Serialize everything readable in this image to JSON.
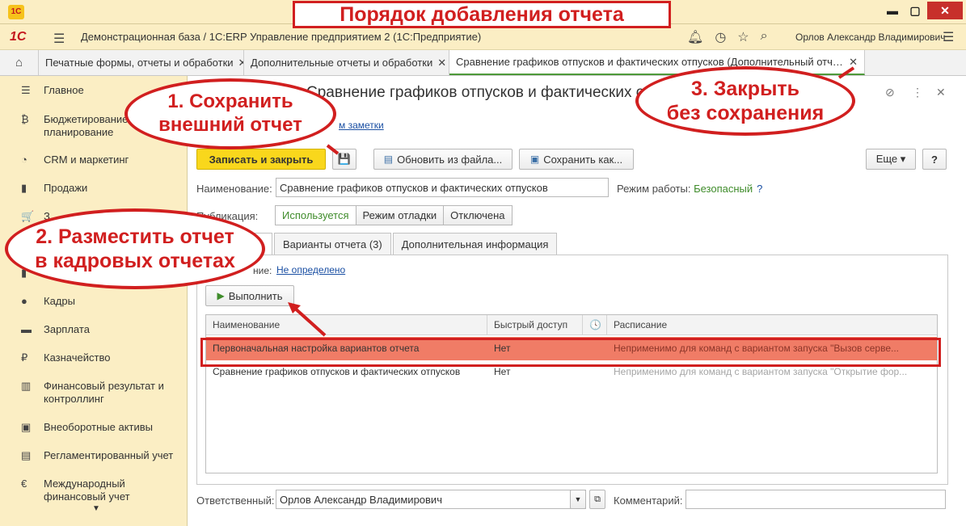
{
  "window": {
    "logo": "1С",
    "btn_min": "▬",
    "btn_max": "▢",
    "btn_close": "✕"
  },
  "annotation_title": "Порядок добавления отчета",
  "header": {
    "brand": "1С",
    "title": "Демонстрационная база / 1С:ERP Управление предприятием 2  (1С:Предприятие)",
    "user": "Орлов Александр Владимирович",
    "icons": [
      "bell-icon",
      "history-icon",
      "star-icon",
      "search-icon"
    ]
  },
  "tabs": [
    {
      "label": "Печатные формы, отчеты и обработки",
      "close": "✕"
    },
    {
      "label": "Дополнительные отчеты и обработки",
      "close": "✕"
    },
    {
      "label": "Сравнение графиков отпусков и фактических отпусков (Дополнительный отчет)",
      "close": "✕"
    }
  ],
  "sidebar": {
    "items": [
      {
        "icon": "☰",
        "label": "Главное"
      },
      {
        "icon": "₿",
        "label": "Бюджетирование и",
        "label2": "планирование"
      },
      {
        "icon": "◔",
        "label": "CRM и маркетинг"
      },
      {
        "icon": "▮",
        "label": "Продажи"
      },
      {
        "icon": "🛒",
        "label": "З"
      },
      {
        "icon": "▮",
        "label": ""
      },
      {
        "icon": "▮",
        "label": ""
      },
      {
        "icon": "●",
        "label": "Кадры"
      },
      {
        "icon": "▬",
        "label": "Зарплата"
      },
      {
        "icon": "₽",
        "label": "Казначейство"
      },
      {
        "icon": "▥",
        "label": "Финансовый результат и",
        "label2": "контроллинг"
      },
      {
        "icon": "▣",
        "label": "Внеоборотные активы"
      },
      {
        "icon": "▤",
        "label": "Регламентированный учет"
      },
      {
        "icon": "€",
        "label": "Международный",
        "label2": "финансовый учет"
      }
    ],
    "more": "▼"
  },
  "form": {
    "title": "Сравнение графиков отпусков и фактических отп",
    "notes_link": "м заметки",
    "controls": {
      "link": "⊘",
      "more": "⋮",
      "close": "✕"
    },
    "buttons": {
      "save_close": "Записать и закрыть",
      "save_icon": "💾",
      "update": "Обновить из файла...",
      "save_as": "Сохранить как...",
      "more": "Еще ▾",
      "help": "?"
    },
    "name_label": "Наименование:",
    "name_value": "Сравнение графиков отпусков и фактических отпусков",
    "mode_label": "Режим работы:",
    "mode_value": "Безопасный",
    "mode_help": "?",
    "pub_label": "Публикация:",
    "publication": [
      "Используется",
      "Режим отладки",
      "Отключена"
    ],
    "tabs": [
      "Команды",
      "Варианты отчета (3)",
      "Дополнительная информация"
    ],
    "placement_label": "ние:",
    "placement_link": "Не определено",
    "run_button": "Выполнить",
    "grid": {
      "columns": [
        "Наименование",
        "Быстрый доступ",
        "🕓",
        "Расписание"
      ],
      "rows": [
        {
          "name": "Первоначальная настройка вариантов отчета",
          "quick": "Нет",
          "schedule": "Неприменимо для команд с вариантом запуска \"Вызов серве..."
        },
        {
          "name": "Сравнение графиков отпусков и фактических отпусков",
          "quick": "Нет",
          "schedule": "Неприменимо для команд с вариантом запуска \"Открытие фор..."
        }
      ]
    },
    "responsible_label": "Ответственный:",
    "responsible_value": "Орлов Александр Владимирович",
    "comment_label": "Комментарий:",
    "comment_value": ""
  },
  "callouts": {
    "c1_line1": "1. Сохранить",
    "c1_line2": "внешний отчет",
    "c2_line1": "2. Разместить отчет",
    "c2_line2": "в кадровых отчетах",
    "c3_line1": "3. Закрыть",
    "c3_line2": "без сохранения"
  },
  "colors": {
    "accent_red": "#d11f1f",
    "brand_yellow": "#f9d71c",
    "highlight_row": "#f07c66"
  }
}
